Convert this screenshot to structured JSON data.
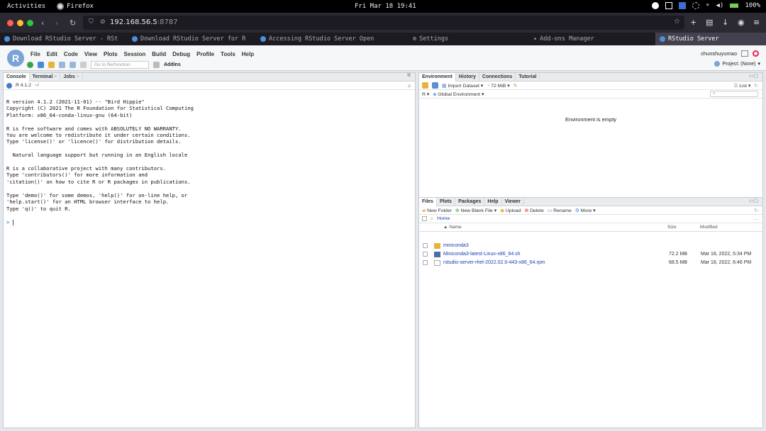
{
  "os": {
    "activities": "Activities",
    "app_name": "Firefox",
    "clock": "Fri Mar 18 19:41",
    "battery": "100%"
  },
  "browser": {
    "url_host": "192.168.56.5",
    "url_port": ":8787",
    "tabs": [
      {
        "label": "Download RStudio Server - RSt"
      },
      {
        "label": "Download RStudio Server for R"
      },
      {
        "label": "Accessing RStudio Server Open"
      },
      {
        "label": "Settings"
      },
      {
        "label": "Add-ons Manager"
      },
      {
        "label": "RStudio Server"
      }
    ]
  },
  "rstudio": {
    "logo_letter": "R",
    "menu": [
      "File",
      "Edit",
      "Code",
      "View",
      "Plots",
      "Session",
      "Build",
      "Debug",
      "Profile",
      "Tools",
      "Help"
    ],
    "goto_placeholder": "Go to file/function",
    "addins_label": "Addins",
    "username": "chunshuyumao",
    "project_label": "Project: (None)",
    "console_pane": {
      "tabs": [
        {
          "label": "Console"
        },
        {
          "label": "Terminal"
        },
        {
          "label": "Jobs"
        }
      ],
      "r_version_label": "R 4.1.2",
      "path": "~/",
      "startup_text": "R version 4.1.2 (2021-11-01) -- \"Bird Hippie\"\nCopyright (C) 2021 The R Foundation for Statistical Computing\nPlatform: x86_64-conda-linux-gnu (64-bit)\n\nR is free software and comes with ABSOLUTELY NO WARRANTY.\nYou are welcome to redistribute it under certain conditions.\nType 'license()' or 'licence()' for distribution details.\n\n  Natural language support but running in an English locale\n\nR is a collaborative project with many contributors.\nType 'contributors()' for more information and\n'citation()' on how to cite R or R packages in publications.\n\nType 'demo()' for some demos, 'help()' for on-line help, or\n'help.start()' for an HTML browser interface to help.\nType 'q()' to quit R.",
      "prompt": ">"
    },
    "env_pane": {
      "tabs": [
        {
          "label": "Environment"
        },
        {
          "label": "History"
        },
        {
          "label": "Connections"
        },
        {
          "label": "Tutorial"
        }
      ],
      "import_dataset": "Import Dataset",
      "memory": "72 MiB",
      "list_label": "List",
      "r_dropdown": "R",
      "global_env": "Global Environment",
      "empty_message": "Environment is empty"
    },
    "files_pane": {
      "tabs": [
        {
          "label": "Files"
        },
        {
          "label": "Plots"
        },
        {
          "label": "Packages"
        },
        {
          "label": "Help"
        },
        {
          "label": "Viewer"
        }
      ],
      "toolbar": {
        "new_folder": "New Folder",
        "new_blank_file": "New Blank File",
        "upload": "Upload",
        "delete": "Delete",
        "rename": "Rename",
        "more": "More"
      },
      "breadcrumb": "Home",
      "columns": {
        "name": "Name",
        "size": "Size",
        "modified": "Modified"
      },
      "rows": [
        {
          "name": "miniconda3",
          "size": "",
          "modified": "",
          "type": "folder"
        },
        {
          "name": "Miniconda3-latest-Linux-x86_64.sh",
          "size": "72.2 MB",
          "modified": "Mar 18, 2022, 5:34 PM",
          "type": "script"
        },
        {
          "name": "rstudio-server-rhel-2022.02.0-443-x86_64.rpm",
          "size": "68.5 MB",
          "modified": "Mar 18, 2022, 6:46 PM",
          "type": "file"
        }
      ]
    }
  }
}
